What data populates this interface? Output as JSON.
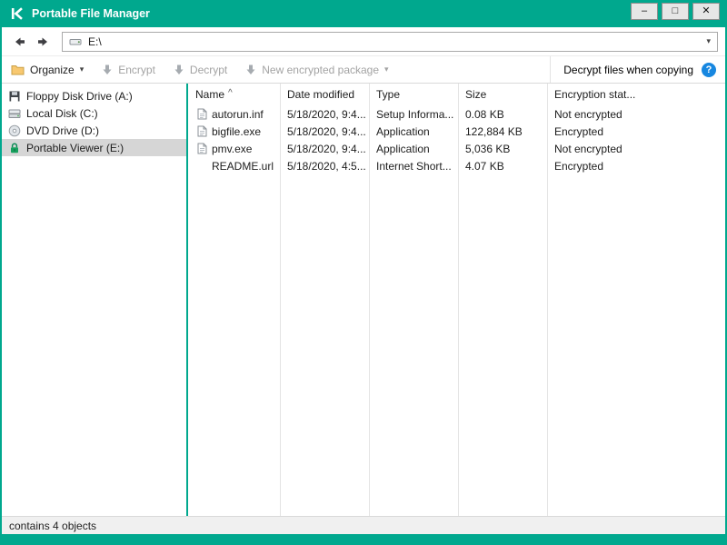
{
  "window": {
    "title": "Portable File Manager"
  },
  "nav": {
    "address_value": "E:\\"
  },
  "toolbar": {
    "organize_label": "Organize",
    "encrypt_label": "Encrypt",
    "decrypt_label": "Decrypt",
    "new_package_label": "New encrypted package",
    "decrypt_copy_label": "Decrypt files when copying"
  },
  "sidebar": {
    "items": [
      {
        "label": "Floppy Disk Drive (A:)",
        "icon": "floppy-disk-icon",
        "selected": false
      },
      {
        "label": "Local Disk (C:)",
        "icon": "hard-disk-icon",
        "selected": false
      },
      {
        "label": "DVD Drive (D:)",
        "icon": "dvd-disc-icon",
        "selected": false
      },
      {
        "label": "Portable Viewer (E:)",
        "icon": "encrypted-drive-lock-icon",
        "selected": true
      }
    ]
  },
  "file_list": {
    "columns": [
      "Name",
      "Date modified",
      "Type",
      "Size",
      "Encryption stat..."
    ],
    "sort_column": "Name",
    "rows": [
      {
        "icon": "setup-file-icon",
        "name": "autorun.inf",
        "date": "5/18/2020, 9:4...",
        "type": "Setup Informa...",
        "size": "0.08 KB",
        "encryption": "Not encrypted"
      },
      {
        "icon": "file-icon",
        "name": "bigfile.exe",
        "date": "5/18/2020, 9:4...",
        "type": "Application",
        "size": "122,884 KB",
        "encryption": "Encrypted"
      },
      {
        "icon": "file-icon",
        "name": "pmv.exe",
        "date": "5/18/2020, 9:4...",
        "type": "Application",
        "size": "5,036 KB",
        "encryption": "Not encrypted"
      },
      {
        "icon": "",
        "name": "README.url",
        "date": "5/18/2020, 4:5...",
        "type": "Internet Short...",
        "size": "4.07 KB",
        "encryption": "Encrypted"
      }
    ]
  },
  "status_bar": {
    "text": "contains 4 objects"
  },
  "icons": {
    "minimize": "–",
    "maximize": "□",
    "close": "✕",
    "dropdown_caret": "▾",
    "sort_ascending": "^",
    "help": "?"
  },
  "colors": {
    "accent_teal": "#00a88e",
    "help_blue": "#1787e0",
    "selection_gray": "#d6d6d6",
    "disabled_text": "#a3a3a3"
  }
}
